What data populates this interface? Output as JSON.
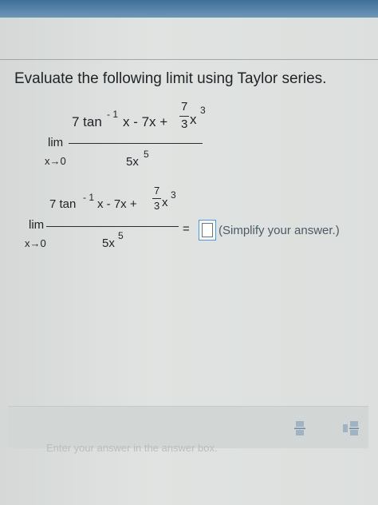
{
  "question": {
    "prompt": "Evaluate the following limit using Taylor series."
  },
  "expression": {
    "lim": "lim",
    "approach": "x→0",
    "num_left": "7 tan",
    "num_exp": "- 1",
    "num_mid": "x - 7x +",
    "frac_num": "7",
    "frac_den": "3",
    "num_var": "x",
    "num_var_exp": "3",
    "denominator": "5x",
    "den_exp": "5"
  },
  "answer": {
    "equals": "=",
    "simplify_note": "(Simplify your answer.)"
  },
  "footer": {
    "hint": "Enter your answer in the answer box."
  },
  "icons": [
    "fraction-tool-icon",
    "mixed-number-tool-icon"
  ]
}
